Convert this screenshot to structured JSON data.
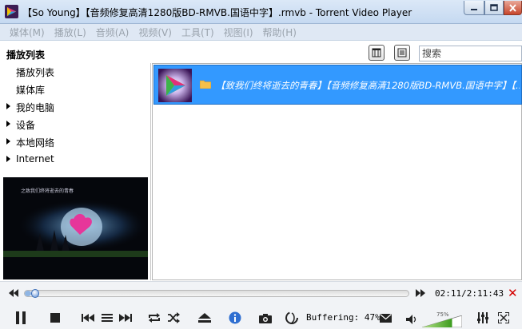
{
  "window": {
    "title": "【So Young】【音频修复高清1280版BD-RMVB.国语中字】.rmvb - Torrent Video Player"
  },
  "menu": [
    "媒体(M)",
    "播放(L)",
    "音频(A)",
    "视频(V)",
    "工具(T)",
    "视图(I)",
    "帮助(H)"
  ],
  "sidebar": {
    "header": "播放列表",
    "items": [
      {
        "label": "播放列表",
        "expandable": false
      },
      {
        "label": "媒体库",
        "expandable": false
      },
      {
        "label": "我的电脑",
        "expandable": true
      },
      {
        "label": "设备",
        "expandable": true
      },
      {
        "label": "本地网络",
        "expandable": true
      },
      {
        "label": "Internet",
        "expandable": true
      }
    ],
    "preview_caption": "之致我们终将逝去的青春"
  },
  "search": {
    "placeholder": "搜索"
  },
  "playlist": {
    "items": [
      {
        "title": "【致我们终将逝去的青春】【音频修复高清1280版BD-RMVB.国语中字】【...",
        "selected": true
      }
    ]
  },
  "playback": {
    "time": "02:11/2:11:43",
    "progress": 0.017,
    "status": "Buffering: 47%",
    "volume_label": "75%",
    "volume": 0.75
  },
  "colors": {
    "selection": "#3399ff",
    "close": "#d40000",
    "accent": "#5d8fd6"
  }
}
